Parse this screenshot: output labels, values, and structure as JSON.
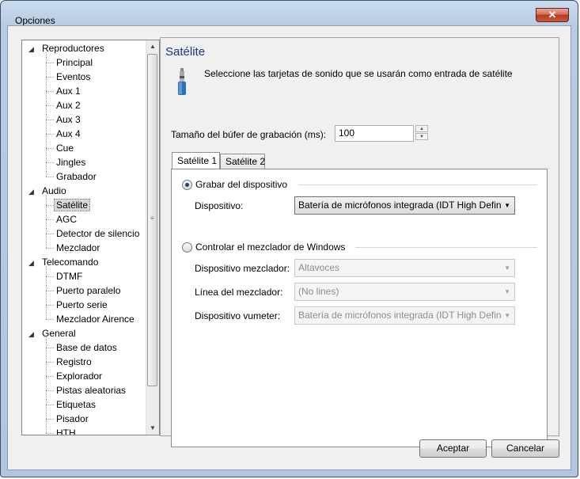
{
  "window": {
    "title": "Opciones",
    "close_glyph": "✕"
  },
  "tree": {
    "groups": [
      {
        "label": "Reproductores",
        "children": [
          "Principal",
          "Eventos",
          "Aux 1",
          "Aux 2",
          "Aux 3",
          "Aux 4",
          "Cue",
          "Jingles",
          "Grabador"
        ]
      },
      {
        "label": "Audio",
        "children": [
          "Satélite",
          "AGC",
          "Detector de silencio",
          "Mezclador"
        ]
      },
      {
        "label": "Telecomando",
        "children": [
          "DTMF",
          "Puerto paralelo",
          "Puerto serie",
          "Mezclador Airence"
        ]
      },
      {
        "label": "General",
        "children": [
          "Base de datos",
          "Registro",
          "Explorador",
          "Pistas aleatorias",
          "Etiquetas",
          "Pisador",
          "HTH"
        ]
      }
    ],
    "selected": "Satélite"
  },
  "panel": {
    "title": "Satélite",
    "description": "Seleccione las tarjetas de sonido que se usarán como entrada de satélite",
    "buffer_label": "Tamaño del búfer de grabación (ms):",
    "buffer_value": "100",
    "tabs": [
      "Satélite 1",
      "Satélite 2"
    ],
    "record_device_option": "Grabar del dispositivo",
    "device_label": "Dispositivo:",
    "device_value": "Batería de micrófonos integrada (IDT High Defin",
    "mixer_option": "Controlar el mezclador de Windows",
    "mixer_device_label": "Dispositivo mezclador:",
    "mixer_device_value": "Altavoces",
    "mixer_line_label": "Línea del mezclador:",
    "mixer_line_value": "(No lines)",
    "vumeter_label": "Dispositivo vumeter:",
    "vumeter_value": "Batería de micrófonos integrada (IDT High Defin"
  },
  "buttons": {
    "accept": "Aceptar",
    "cancel": "Cancelar"
  },
  "icons": {
    "microphone": "jack-plug-icon"
  }
}
